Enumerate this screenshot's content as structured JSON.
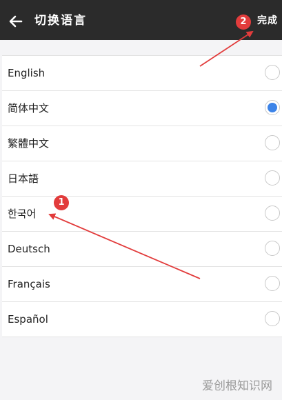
{
  "header": {
    "title": "切换语言",
    "done_label": "完成",
    "back_icon": "arrow-left-icon"
  },
  "languages": [
    {
      "label": "English",
      "selected": false
    },
    {
      "label": "简体中文",
      "selected": true
    },
    {
      "label": "繁體中文",
      "selected": false
    },
    {
      "label": "日本語",
      "selected": false
    },
    {
      "label": "한국어",
      "selected": false
    },
    {
      "label": "Deutsch",
      "selected": false
    },
    {
      "label": "Français",
      "selected": false
    },
    {
      "label": "Español",
      "selected": false
    }
  ],
  "annotations": {
    "badge_1": "1",
    "badge_2": "2",
    "color": "#e23c3c"
  },
  "watermark": "爱创根知识网",
  "colors": {
    "header_bg": "#2b2b2b",
    "radio_selected": "#3d84e8"
  }
}
